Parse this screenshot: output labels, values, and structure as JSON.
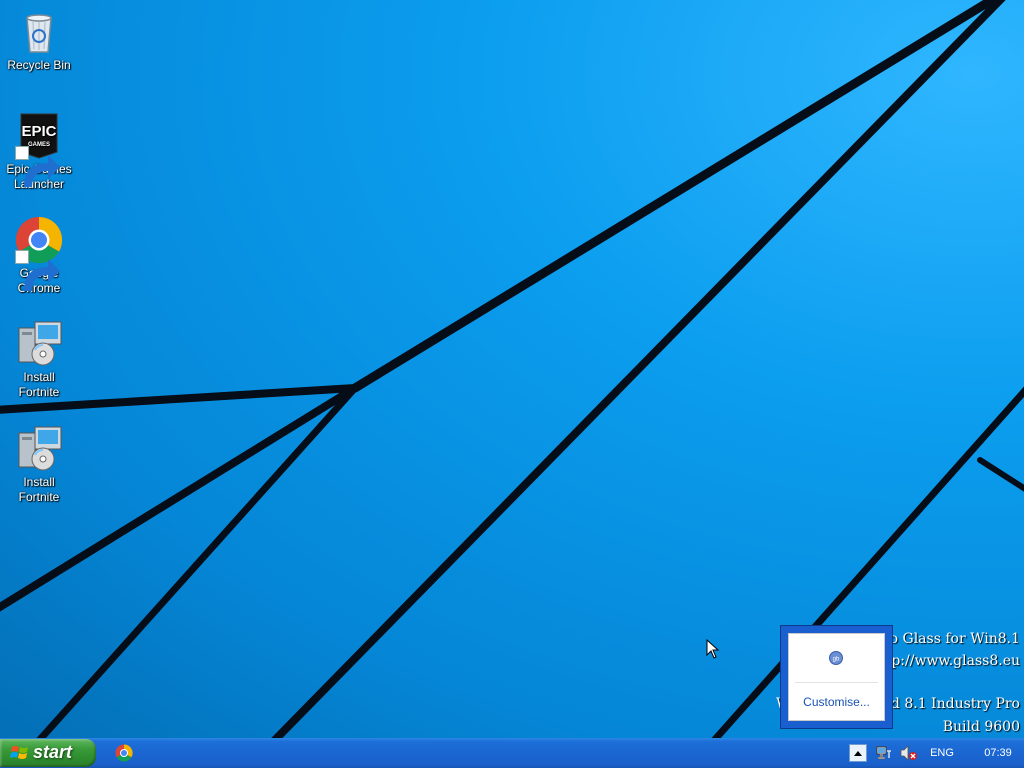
{
  "desktop": {
    "icons": [
      {
        "label": "Recycle Bin",
        "icon": "recycle-bin-icon"
      },
      {
        "label": "Epic Games Launcher",
        "icon": "epic-games-icon"
      },
      {
        "label": "Google Chrome",
        "icon": "chrome-icon"
      },
      {
        "label": "Install Fortnite",
        "icon": "installer-icon"
      },
      {
        "label": "Install Fortnite",
        "icon": "installer-icon"
      }
    ],
    "watermark": {
      "line1": "ero Glass for Win8.1",
      "line2": "ttp://www.glass8.eu",
      "line3": "W",
      "line3b": "ded 8.1 Industry Pro",
      "line4": "Build 9600"
    }
  },
  "tray_popup": {
    "app_icon": "aero-glass-icon",
    "app_icon_text": "gb",
    "customise_label": "Customise..."
  },
  "taskbar": {
    "start_label": "start",
    "quicklaunch": [
      {
        "icon": "chrome-icon"
      }
    ],
    "tray": {
      "expand_icon": "chevron-up-icon",
      "network_icon": "network-icon",
      "volume_icon": "volume-muted-icon",
      "language": "ENG",
      "clock": "07:39"
    }
  },
  "colors": {
    "wallpaper": "#0c9eef",
    "taskbar": "#1b66d2",
    "start_button": "#3a9b3a",
    "popup_frame": "#1a5fd0",
    "link": "#1a52b4"
  }
}
